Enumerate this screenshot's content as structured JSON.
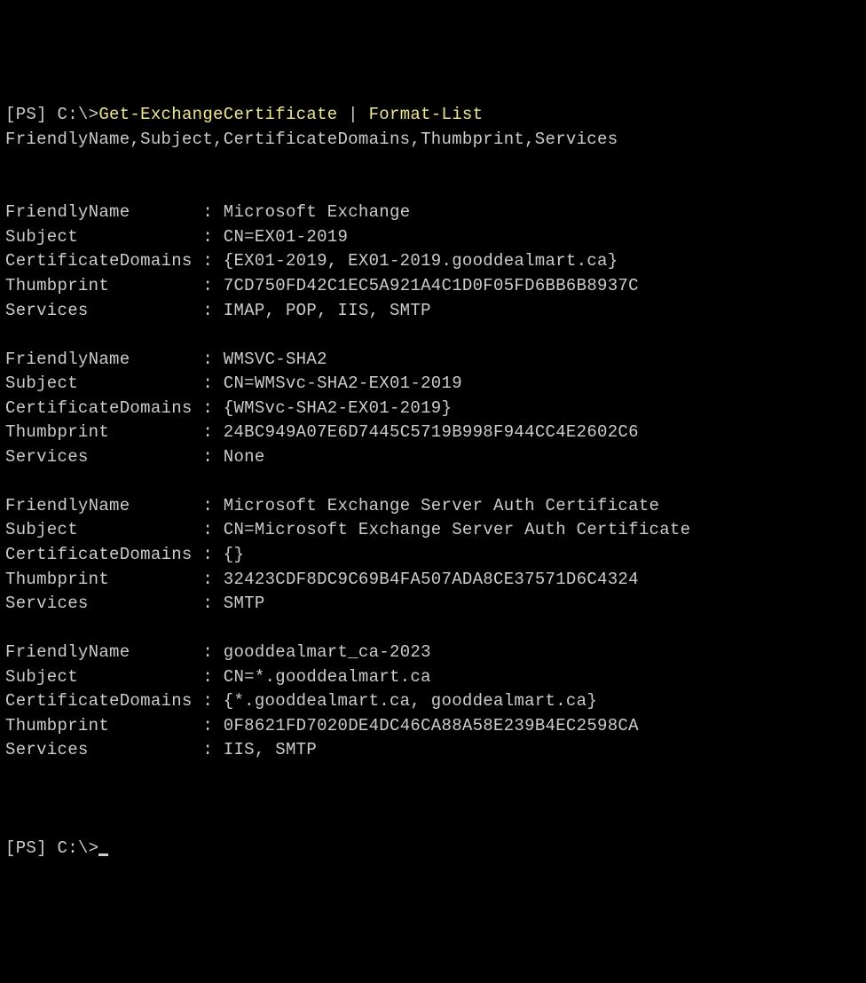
{
  "prompt": {
    "bracket_open": "[",
    "ps": "PS",
    "bracket_close": "]",
    "path": " C:\\",
    "arrow": ">"
  },
  "command": {
    "cmdlet1": "Get-ExchangeCertificate",
    "pipe": " | ",
    "cmdlet2": "Format-List",
    "args": " FriendlyName,Subject,CertificateDomains,Thumbprint,Services"
  },
  "certificates": [
    {
      "FriendlyName": "Microsoft Exchange",
      "Subject": "CN=EX01-2019",
      "CertificateDomains": "{EX01-2019, EX01-2019.gooddealmart.ca}",
      "Thumbprint": "7CD750FD42C1EC5A921A4C1D0F05FD6BB6B8937C",
      "Services": "IMAP, POP, IIS, SMTP"
    },
    {
      "FriendlyName": "WMSVC-SHA2",
      "Subject": "CN=WMSvc-SHA2-EX01-2019",
      "CertificateDomains": "{WMSvc-SHA2-EX01-2019}",
      "Thumbprint": "24BC949A07E6D7445C5719B998F944CC4E2602C6",
      "Services": "None"
    },
    {
      "FriendlyName": "Microsoft Exchange Server Auth Certificate",
      "Subject": "CN=Microsoft Exchange Server Auth Certificate",
      "CertificateDomains": "{}",
      "Thumbprint": "32423CDF8DC9C69B4FA507ADA8CE37571D6C4324",
      "Services": "SMTP"
    },
    {
      "FriendlyName": "gooddealmart_ca-2023",
      "Subject": "CN=*.gooddealmart.ca",
      "CertificateDomains": "{*.gooddealmart.ca, gooddealmart.ca}",
      "Thumbprint": "0F8621FD7020DE4DC46CA88A58E239B4EC2598CA",
      "Services": "IIS, SMTP"
    }
  ],
  "labels": {
    "FriendlyName": "FriendlyName",
    "Subject": "Subject",
    "CertificateDomains": "CertificateDomains",
    "Thumbprint": "Thumbprint",
    "Services": "Services"
  }
}
